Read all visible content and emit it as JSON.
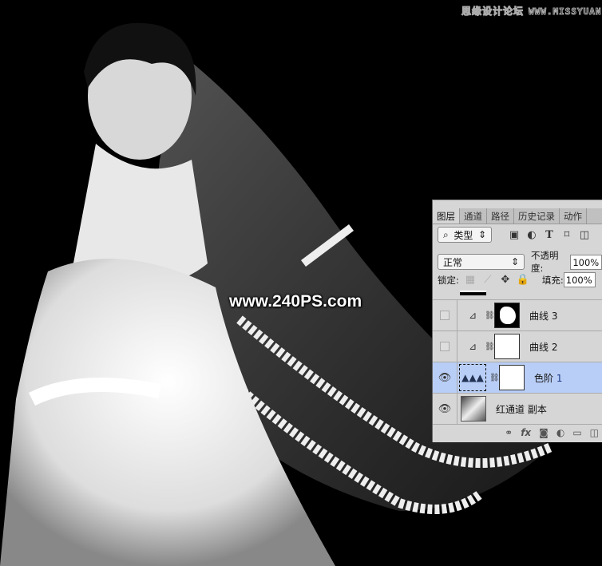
{
  "watermarks": {
    "top_cn": "思缘设计论坛",
    "top_url": "WWW.MISSYUAN.COM",
    "center": "www.240PS.com"
  },
  "panel": {
    "tabs": [
      {
        "label": "图层",
        "active": true
      },
      {
        "label": "通道"
      },
      {
        "label": "路径"
      },
      {
        "label": "历史记录"
      },
      {
        "label": "动作"
      }
    ],
    "filter": {
      "label": "类型",
      "icons": [
        "image-filter-icon",
        "adjustment-filter-icon",
        "type-filter-icon",
        "shape-filter-icon",
        "smart-object-filter-icon"
      ]
    },
    "blend_mode": "正常",
    "opacity_label": "不透明度:",
    "opacity": "100%",
    "lock_label": "锁定:",
    "fill_label": "填充:",
    "fill": "100%",
    "layers": [
      {
        "name": "曲线",
        "num": "3",
        "visible": false,
        "type": "curves"
      },
      {
        "name": "曲线",
        "num": "2",
        "visible": false,
        "type": "curves"
      },
      {
        "name": "色阶",
        "num": "1",
        "visible": true,
        "type": "levels",
        "selected": true
      },
      {
        "name": "红通道 副本",
        "num": "",
        "visible": true,
        "type": "pixel"
      }
    ],
    "footer_icons": [
      "link-icon",
      "fx-icon",
      "mask-icon",
      "adjustment-icon",
      "folder-icon",
      "new-layer-icon"
    ]
  },
  "colors": {
    "selected": "#b9cef6",
    "panel": "#d6d6d6"
  }
}
